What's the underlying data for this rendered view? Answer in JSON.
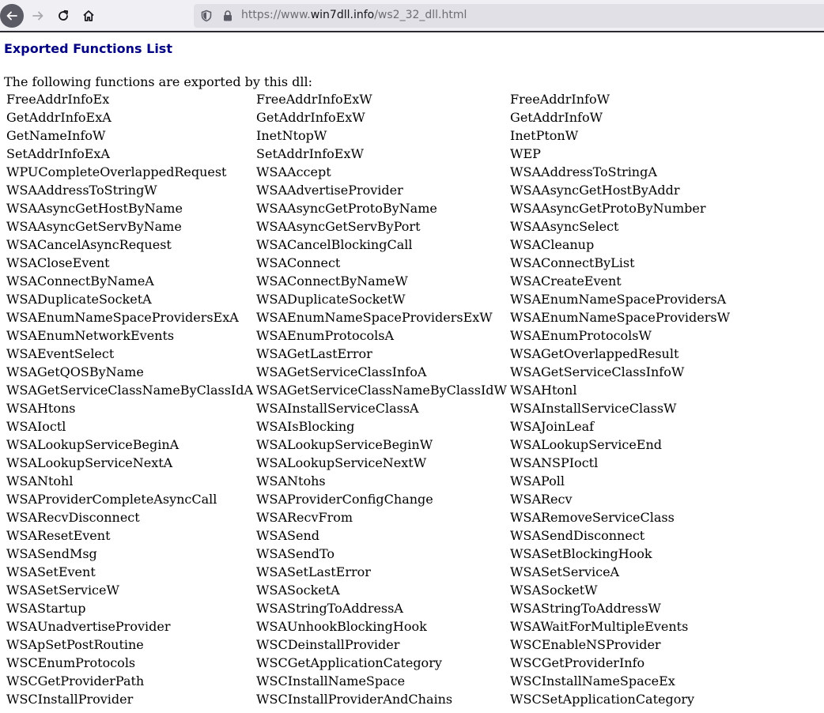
{
  "browser": {
    "url_prefix": "https://www.",
    "url_domain": "win7dll.info",
    "url_path": "/ws2_32_dll.html",
    "icons": {
      "back": "arrow-left-icon",
      "forward": "arrow-right-icon",
      "reload": "reload-icon",
      "home": "home-icon",
      "tracking": "shield-icon",
      "secure": "lock-icon"
    }
  },
  "page": {
    "section_title": "Exported Functions List",
    "intro": "The following functions are exported by this dll:",
    "title_color": "#000080"
  },
  "functions": [
    [
      "FreeAddrInfoEx",
      "FreeAddrInfoExW",
      "FreeAddrInfoW"
    ],
    [
      "GetAddrInfoExA",
      "GetAddrInfoExW",
      "GetAddrInfoW"
    ],
    [
      "GetNameInfoW",
      "InetNtopW",
      "InetPtonW"
    ],
    [
      "SetAddrInfoExA",
      "SetAddrInfoExW",
      "WEP"
    ],
    [
      "WPUCompleteOverlappedRequest",
      "WSAAccept",
      "WSAAddressToStringA"
    ],
    [
      "WSAAddressToStringW",
      "WSAAdvertiseProvider",
      "WSAAsyncGetHostByAddr"
    ],
    [
      "WSAAsyncGetHostByName",
      "WSAAsyncGetProtoByName",
      "WSAAsyncGetProtoByNumber"
    ],
    [
      "WSAAsyncGetServByName",
      "WSAAsyncGetServByPort",
      "WSAAsyncSelect"
    ],
    [
      "WSACancelAsyncRequest",
      "WSACancelBlockingCall",
      "WSACleanup"
    ],
    [
      "WSACloseEvent",
      "WSAConnect",
      "WSAConnectByList"
    ],
    [
      "WSAConnectByNameA",
      "WSAConnectByNameW",
      "WSACreateEvent"
    ],
    [
      "WSADuplicateSocketA",
      "WSADuplicateSocketW",
      "WSAEnumNameSpaceProvidersA"
    ],
    [
      "WSAEnumNameSpaceProvidersExA",
      "WSAEnumNameSpaceProvidersExW",
      "WSAEnumNameSpaceProvidersW"
    ],
    [
      "WSAEnumNetworkEvents",
      "WSAEnumProtocolsA",
      "WSAEnumProtocolsW"
    ],
    [
      "WSAEventSelect",
      "WSAGetLastError",
      "WSAGetOverlappedResult"
    ],
    [
      "WSAGetQOSByName",
      "WSAGetServiceClassInfoA",
      "WSAGetServiceClassInfoW"
    ],
    [
      "WSAGetServiceClassNameByClassIdA",
      "WSAGetServiceClassNameByClassIdW",
      "WSAHtonl"
    ],
    [
      "WSAHtons",
      "WSAInstallServiceClassA",
      "WSAInstallServiceClassW"
    ],
    [
      "WSAIoctl",
      "WSAIsBlocking",
      "WSAJoinLeaf"
    ],
    [
      "WSALookupServiceBeginA",
      "WSALookupServiceBeginW",
      "WSALookupServiceEnd"
    ],
    [
      "WSALookupServiceNextA",
      "WSALookupServiceNextW",
      "WSANSPIoctl"
    ],
    [
      "WSANtohl",
      "WSANtohs",
      "WSAPoll"
    ],
    [
      "WSAProviderCompleteAsyncCall",
      "WSAProviderConfigChange",
      "WSARecv"
    ],
    [
      "WSARecvDisconnect",
      "WSARecvFrom",
      "WSARemoveServiceClass"
    ],
    [
      "WSAResetEvent",
      "WSASend",
      "WSASendDisconnect"
    ],
    [
      "WSASendMsg",
      "WSASendTo",
      "WSASetBlockingHook"
    ],
    [
      "WSASetEvent",
      "WSASetLastError",
      "WSASetServiceA"
    ],
    [
      "WSASetServiceW",
      "WSASocketA",
      "WSASocketW"
    ],
    [
      "WSAStartup",
      "WSAStringToAddressA",
      "WSAStringToAddressW"
    ],
    [
      "WSAUnadvertiseProvider",
      "WSAUnhookBlockingHook",
      "WSAWaitForMultipleEvents"
    ],
    [
      "WSApSetPostRoutine",
      "WSCDeinstallProvider",
      "WSCEnableNSProvider"
    ],
    [
      "WSCEnumProtocols",
      "WSCGetApplicationCategory",
      "WSCGetProviderInfo"
    ],
    [
      "WSCGetProviderPath",
      "WSCInstallNameSpace",
      "WSCInstallNameSpaceEx"
    ],
    [
      "WSCInstallProvider",
      "WSCInstallProviderAndChains",
      "WSCSetApplicationCategory"
    ]
  ]
}
